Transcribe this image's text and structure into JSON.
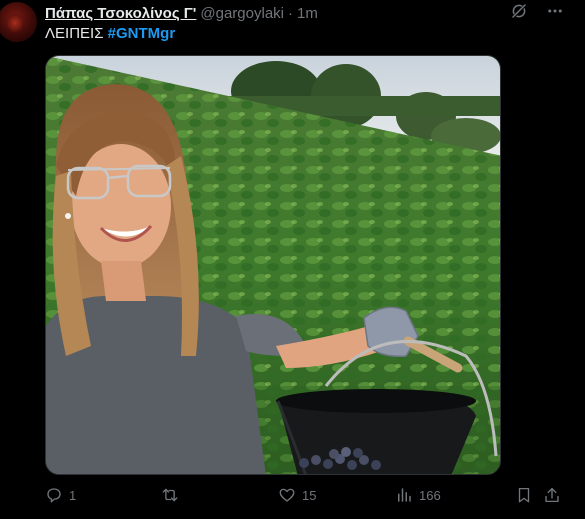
{
  "tweet": {
    "display_name": "Πάπας Τσοκολίνος Γ'",
    "handle": "@gargoylaki",
    "separator": "·",
    "time": "1m",
    "text": "ΛΕΙΠΕΙΣ",
    "hashtag": "#GNTMgr"
  },
  "actions": {
    "replies": "1",
    "retweets": "",
    "likes": "15",
    "views": "166"
  },
  "icons": {
    "header": [
      "grok-icon",
      "more-options-icon"
    ],
    "actions": [
      "reply-icon",
      "retweet-icon",
      "like-icon",
      "views-icon",
      "bookmark-icon",
      "share-icon"
    ]
  },
  "colors": {
    "background": "#000000",
    "text": "#e7e9ea",
    "muted": "#71767b",
    "accent": "#1d9bf0"
  }
}
